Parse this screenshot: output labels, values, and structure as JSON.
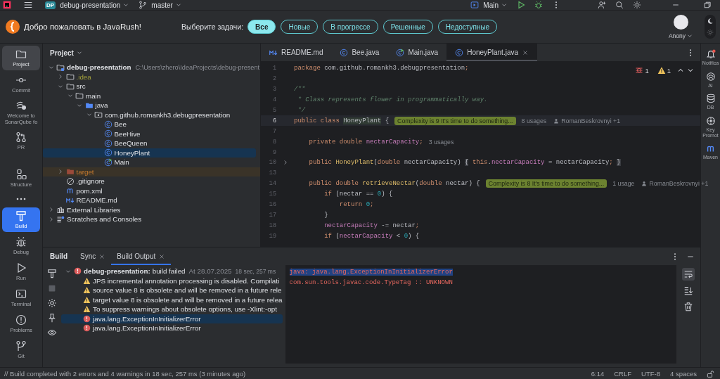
{
  "title_bar": {
    "project_badge": "DP",
    "project": "debug-presentation",
    "branch": "master",
    "run_config": "Main"
  },
  "javarush": {
    "welcome": "Добро пожаловать в JavaRush!",
    "filter_label": "Выберите задачи:",
    "filters": [
      {
        "label": "Все",
        "selected": true
      },
      {
        "label": "Новые",
        "selected": false
      },
      {
        "label": "В прогрессе",
        "selected": false
      },
      {
        "label": "Решенные",
        "selected": false
      },
      {
        "label": "Недоступные",
        "selected": false
      }
    ],
    "user": "Anony",
    "theme_switch": {
      "dark": true
    }
  },
  "tool_windows": [
    {
      "label": "Project",
      "kind": "project",
      "selected": true,
      "focused": false
    },
    {
      "label": "Commit",
      "kind": "commit",
      "selected": false,
      "focused": false
    },
    {
      "label": "Welcome to SonarQube fo",
      "kind": "sonar",
      "selected": false,
      "focused": false
    },
    {
      "label": "PR",
      "kind": "pr",
      "selected": false,
      "focused": false
    },
    {
      "label": "Structure",
      "kind": "structure",
      "selected": false,
      "focused": false
    },
    {
      "kind": "more"
    },
    {
      "label": "Build",
      "kind": "build",
      "selected": true,
      "focused": true
    },
    {
      "label": "Debug",
      "kind": "debug",
      "selected": false,
      "focused": false
    },
    {
      "label": "Run",
      "kind": "run",
      "selected": false,
      "focused": false
    },
    {
      "label": "Terminal",
      "kind": "terminal",
      "selected": false,
      "focused": false
    },
    {
      "label": "Problems",
      "kind": "problems",
      "selected": false,
      "focused": false
    },
    {
      "label": "Git",
      "kind": "git",
      "selected": false,
      "focused": false
    }
  ],
  "right_tools": [
    {
      "label": "Notifica",
      "kind": "notifications"
    },
    {
      "label": "AI",
      "kind": "ai"
    },
    {
      "label": "DB",
      "kind": "db"
    },
    {
      "label": "Key Promot",
      "kind": "key"
    },
    {
      "label": "Maven",
      "kind": "maven"
    }
  ],
  "project": {
    "title": "Project",
    "tree": [
      {
        "label": "debug-presentation",
        "path": "C:\\Users\\zhero\\IdeaProjects\\debug-present",
        "kind": "module",
        "expanded": true,
        "selected": false,
        "children": [
          {
            "label": ".idea",
            "kind": "ignored-folder",
            "expanded": false,
            "selected": false
          },
          {
            "label": "src",
            "kind": "folder",
            "expanded": true,
            "selected": false,
            "children": [
              {
                "label": "main",
                "kind": "folder",
                "expanded": true,
                "selected": false,
                "children": [
                  {
                    "label": "java",
                    "kind": "source-folder",
                    "expanded": true,
                    "selected": false,
                    "children": [
                      {
                        "label": "com.github.romankh3.debugpresentation",
                        "kind": "package",
                        "expanded": true,
                        "selected": false,
                        "children": [
                          {
                            "label": "Bee",
                            "kind": "class",
                            "selected": false
                          },
                          {
                            "label": "BeeHive",
                            "kind": "class",
                            "selected": false
                          },
                          {
                            "label": "BeeQueen",
                            "kind": "class",
                            "selected": false
                          },
                          {
                            "label": "HoneyPlant",
                            "kind": "class",
                            "selected": true
                          },
                          {
                            "label": "Main",
                            "kind": "main-class",
                            "selected": false
                          }
                        ]
                      }
                    ]
                  }
                ]
              }
            ]
          },
          {
            "label": "target",
            "kind": "excluded-folder",
            "expanded": false,
            "selected": false
          },
          {
            "label": ".gitignore",
            "kind": "gitignore",
            "selected": false
          },
          {
            "label": "pom.xml",
            "kind": "maven",
            "selected": false
          },
          {
            "label": "README.md",
            "kind": "markdown",
            "selected": false
          }
        ]
      },
      {
        "label": "External Libraries",
        "kind": "library",
        "expanded": false,
        "selected": false
      },
      {
        "label": "Scratches and Consoles",
        "kind": "scratches",
        "expanded": false,
        "selected": false
      }
    ]
  },
  "editor": {
    "tabs": [
      {
        "label": "README.md",
        "kind": "markdown",
        "selected": false
      },
      {
        "label": "Bee.java",
        "kind": "class",
        "selected": false
      },
      {
        "label": "Main.java",
        "kind": "main-class",
        "selected": false
      },
      {
        "label": "HoneyPlant.java",
        "kind": "class",
        "selected": true
      }
    ],
    "errors": "1",
    "warnings": "1",
    "lines": [
      {
        "number": "1",
        "current": false,
        "folded": false,
        "tokens": [
          {
            "kind": "kw",
            "text": "package "
          },
          {
            "kind": "plain",
            "text": "com.github.romankh3.debugpresentation"
          },
          {
            "kind": "kw",
            "text": ";"
          }
        ]
      },
      {
        "number": "2",
        "current": false,
        "folded": false
      },
      {
        "number": "3",
        "current": false,
        "folded": false,
        "tokens": [
          {
            "kind": "comment",
            "text": "/**"
          }
        ]
      },
      {
        "number": "4",
        "current": false,
        "folded": false,
        "tokens": [
          {
            "kind": "comment",
            "text": " * Class represents flower in programmatically way."
          }
        ]
      },
      {
        "number": "5",
        "current": false,
        "folded": false,
        "tokens": [
          {
            "kind": "comment",
            "text": " */"
          }
        ]
      },
      {
        "number": "6",
        "current": true,
        "folded": false,
        "tokens": [
          {
            "kind": "kw",
            "text": "public class "
          },
          {
            "kind": "hl",
            "text": "HoneyPlant"
          },
          {
            "kind": "plain",
            "text": " {"
          }
        ],
        "hints": [
          {
            "kind": "complexity",
            "text": "Complexity is 9 It's time to do something..."
          },
          {
            "kind": "usages",
            "text": "8 usages"
          },
          {
            "kind": "author",
            "text": "RomanBeskrovnyi +1"
          }
        ]
      },
      {
        "number": "7",
        "current": false,
        "folded": false
      },
      {
        "number": "8",
        "current": false,
        "folded": false,
        "tokens": [
          {
            "kind": "kw",
            "text": "    private double "
          },
          {
            "kind": "field",
            "text": "nectarCapacity"
          },
          {
            "kind": "kw",
            "text": ";"
          }
        ],
        "hints": [
          {
            "kind": "usages",
            "text": "3 usages"
          }
        ]
      },
      {
        "number": "9",
        "current": false,
        "folded": false
      },
      {
        "number": "10",
        "current": false,
        "folded": true,
        "tokens": [
          {
            "kind": "kw",
            "text": "    public "
          },
          {
            "kind": "decl",
            "text": "HoneyPlant"
          },
          {
            "kind": "plain",
            "text": "("
          },
          {
            "kind": "kw",
            "text": "double "
          },
          {
            "kind": "plain",
            "text": "nectarCapacity) "
          },
          {
            "kind": "fold",
            "text": "{"
          },
          {
            "kind": "kw",
            "text": " this"
          },
          {
            "kind": "plain",
            "text": "."
          },
          {
            "kind": "field",
            "text": "nectarCapacity"
          },
          {
            "kind": "plain",
            "text": " = nectarCapacity"
          },
          {
            "kind": "kw",
            "text": "; "
          },
          {
            "kind": "fold",
            "text": "}"
          }
        ]
      },
      {
        "number": "13",
        "current": false,
        "folded": false
      },
      {
        "number": "14",
        "current": false,
        "folded": false,
        "tokens": [
          {
            "kind": "kw",
            "text": "    public double "
          },
          {
            "kind": "decl",
            "text": "retrieveNectar"
          },
          {
            "kind": "plain",
            "text": "("
          },
          {
            "kind": "kw",
            "text": "double "
          },
          {
            "kind": "plain",
            "text": "nectar) {"
          }
        ],
        "hints": [
          {
            "kind": "complexity",
            "text": "Complexity is 8 It's time to do something..."
          },
          {
            "kind": "usages",
            "text": "1 usage"
          },
          {
            "kind": "author",
            "text": "RomanBeskrovnyi +1"
          }
        ]
      },
      {
        "number": "15",
        "current": false,
        "folded": false,
        "tokens": [
          {
            "kind": "kw",
            "text": "        if "
          },
          {
            "kind": "plain",
            "text": "(nectar == "
          },
          {
            "kind": "num",
            "text": "0"
          },
          {
            "kind": "plain",
            "text": ") {"
          }
        ]
      },
      {
        "number": "16",
        "current": false,
        "folded": false,
        "tokens": [
          {
            "kind": "kw",
            "text": "            return "
          },
          {
            "kind": "num",
            "text": "0"
          },
          {
            "kind": "kw",
            "text": ";"
          }
        ]
      },
      {
        "number": "17",
        "current": false,
        "folded": false,
        "tokens": [
          {
            "kind": "plain",
            "text": "        }"
          }
        ]
      },
      {
        "number": "18",
        "current": false,
        "folded": false,
        "tokens": [
          {
            "kind": "field",
            "text": "        nectarCapacity"
          },
          {
            "kind": "plain",
            "text": " -= nectar"
          },
          {
            "kind": "kw",
            "text": ";"
          }
        ]
      },
      {
        "number": "19",
        "current": false,
        "folded": false,
        "tokens": [
          {
            "kind": "kw",
            "text": "        if "
          },
          {
            "kind": "plain",
            "text": "("
          },
          {
            "kind": "field",
            "text": "nectarCapacity"
          },
          {
            "kind": "plain",
            "text": " < "
          },
          {
            "kind": "num",
            "text": "0"
          },
          {
            "kind": "plain",
            "text": ") {"
          }
        ]
      }
    ]
  },
  "build": {
    "title": "Build",
    "tabs": [
      {
        "label": "Sync",
        "selected": false
      },
      {
        "label": "Build Output",
        "selected": true
      }
    ],
    "tree": [
      {
        "kind": "error",
        "title": "debug-presentation:",
        "status": "build failed",
        "date": "At 28.07.2025",
        "duration": "18 sec, 257 ms",
        "expanded": true,
        "selected": false,
        "children": [
          {
            "kind": "warning",
            "text": "JPS incremental annotation processing is disabled. Compilati",
            "selected": false
          },
          {
            "kind": "warning",
            "text": "source value 8 is obsolete and will be removed in a future rele",
            "selected": false
          },
          {
            "kind": "warning",
            "text": "target value 8 is obsolete and will be removed in a future relea",
            "selected": false
          },
          {
            "kind": "warning",
            "text": "To suppress warnings about obsolete options, use -Xlint:-opt",
            "selected": false
          },
          {
            "kind": "error",
            "text": "java.lang.ExceptionInInitializerError",
            "selected": true
          },
          {
            "kind": "error",
            "text": "java.lang.ExceptionInInitializerError",
            "selected": false
          }
        ]
      }
    ],
    "console": [
      {
        "text": "java: java.lang.ExceptionInInitializerError",
        "selected": true
      },
      {
        "text": "com.sun.tools.javac.code.TypeTag :: UNKNOWN",
        "selected": false
      }
    ],
    "soft_wrap": {
      "on": true
    }
  },
  "status_bar": {
    "message": "// Build completed with 2 errors and 4 warnings in 18 sec, 257 ms (3 minutes ago)",
    "position": "6:14",
    "line_separator": "CRLF",
    "encoding": "UTF-8",
    "indent": "4 spaces"
  }
}
